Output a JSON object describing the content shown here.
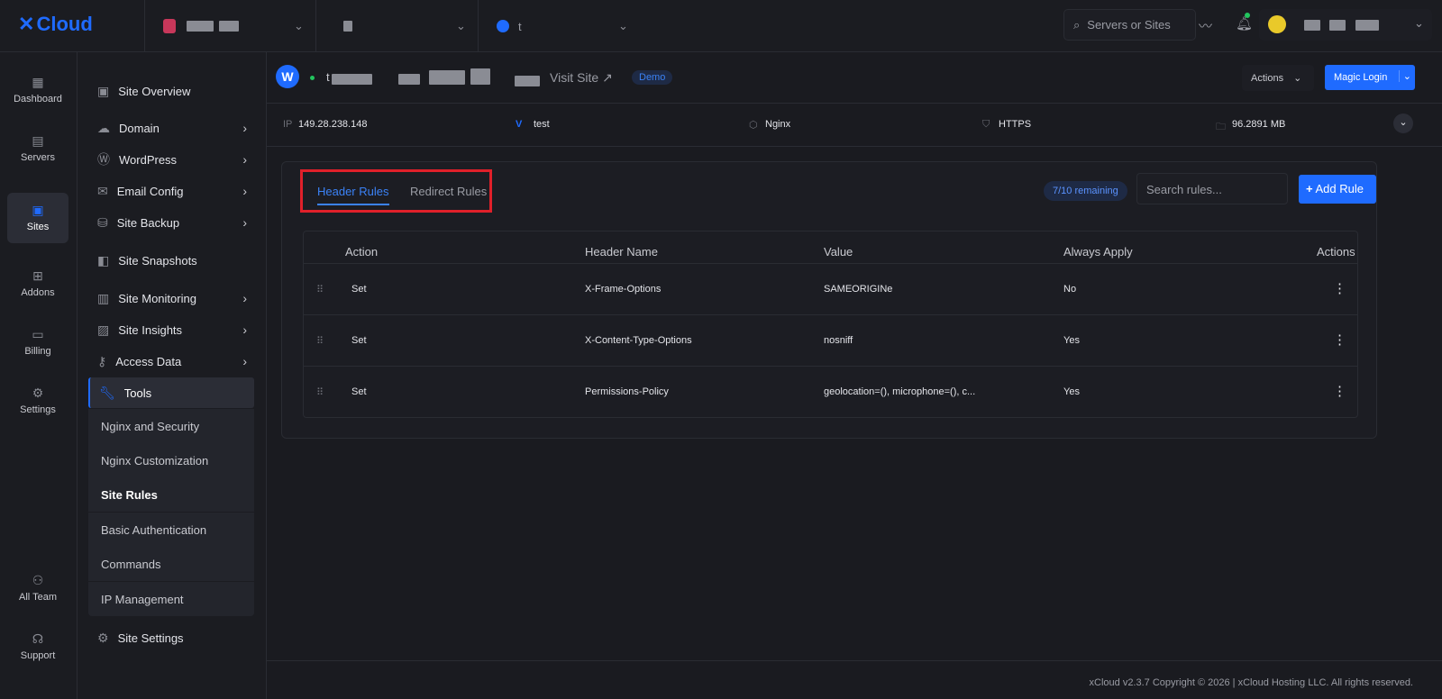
{
  "brand": {
    "name": "Cloud",
    "accent": "#1f6bff"
  },
  "topbar": {
    "crumb3_initial": "t",
    "search_placeholder": "Servers or Sites"
  },
  "rail": [
    {
      "label": "Dashboard",
      "icon": "grid-icon"
    },
    {
      "label": "Servers",
      "icon": "server-icon"
    },
    {
      "label": "Sites",
      "icon": "browser-icon"
    },
    {
      "label": "Addons",
      "icon": "addons-icon"
    },
    {
      "label": "Billing",
      "icon": "receipt-icon"
    },
    {
      "label": "Settings",
      "icon": "gear-icon"
    },
    {
      "label": "All Team",
      "icon": "team-icon"
    },
    {
      "label": "Support",
      "icon": "headset-icon"
    }
  ],
  "nav": {
    "items": [
      "Site Overview",
      "Domain",
      "WordPress",
      "Email Config",
      "Site Backup",
      "Site Snapshots",
      "Site Monitoring",
      "Site Insights",
      "Access Data",
      "Tools"
    ],
    "tools_sub": [
      "Nginx and Security",
      "Nginx Customization",
      "Site Rules",
      "Basic Authentication",
      "Commands",
      "IP Management"
    ],
    "settings": "Site Settings"
  },
  "site": {
    "initial": "t",
    "visit_label": "Visit Site ↗",
    "badge": "Demo",
    "actions_label": "Actions",
    "magic_login": "Magic Login"
  },
  "info": {
    "ip_label": "IP",
    "ip": "149.28.238.148",
    "php": "test",
    "server": "Nginx",
    "ssl": "HTTPS",
    "size": "96.2891 MB"
  },
  "rules": {
    "tabs": [
      "Header Rules",
      "Redirect Rules"
    ],
    "remaining": "7/10 remaining",
    "search_placeholder": "Search rules...",
    "add_label": "Add Rule",
    "columns": [
      "Action",
      "Header Name",
      "Value",
      "Always Apply",
      "Actions"
    ],
    "rows": [
      {
        "action": "Set",
        "name": "X-Frame-Options",
        "value": "SAMEORIGINe",
        "always": "No"
      },
      {
        "action": "Set",
        "name": "X-Content-Type-Options",
        "value": "nosniff",
        "always": "Yes"
      },
      {
        "action": "Set",
        "name": "Permissions-Policy",
        "value": "geolocation=(), microphone=(), c...",
        "always": "Yes"
      }
    ]
  },
  "footer": "xCloud v2.3.7 Copyright © 2026 | xCloud Hosting LLC. All rights reserved."
}
